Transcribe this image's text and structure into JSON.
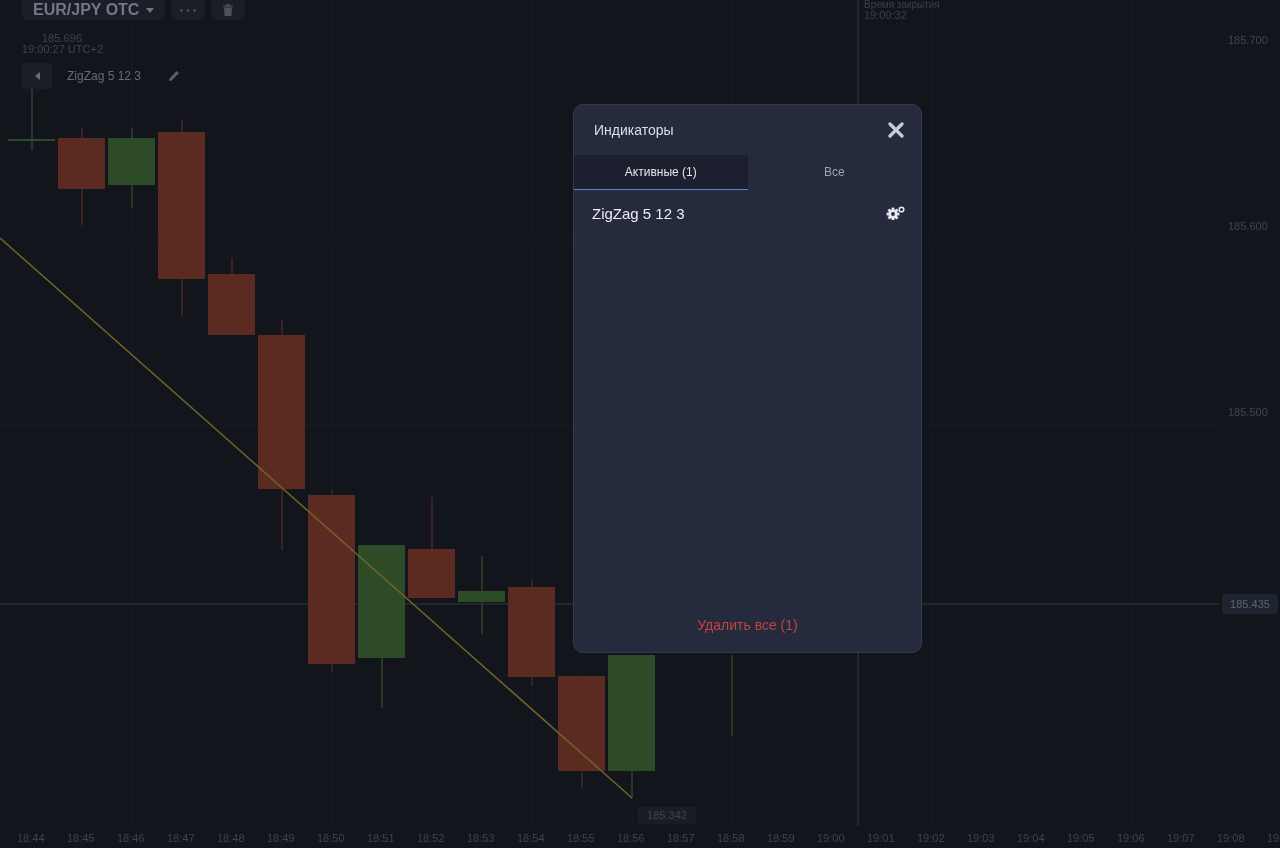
{
  "toolbar": {
    "symbol": "EUR/JPY OTC"
  },
  "crosshair": {
    "price": "185.696",
    "time": "19:00:27 UTC+2"
  },
  "indicator_legend": {
    "name": "ZigZag 5 12 3"
  },
  "close_time": {
    "label": "Время закрытия",
    "time": "19:00:32"
  },
  "chart": {
    "price_axis": [
      "185.700",
      "185.600",
      "185.500"
    ],
    "current_price": "185.435",
    "low_price": "185.342",
    "time_axis": [
      "18:44",
      "18:45",
      "18:46",
      "18:47",
      "18:48",
      "18:49",
      "18:50",
      "18:51",
      "18:52",
      "18:53",
      "18:54",
      "18:55",
      "18:56",
      "18:57",
      "18:58",
      "18:59",
      "19:00",
      "19:01",
      "19:02",
      "19:03",
      "19:04",
      "19:05",
      "19:06",
      "19:07",
      "19:08",
      "19"
    ]
  },
  "dialog": {
    "title": "Индикаторы",
    "tabs": [
      {
        "label": "Активные (1)",
        "selected": true
      },
      {
        "label": "Все",
        "selected": false
      }
    ],
    "indicators": [
      {
        "name": "ZigZag 5 12 3"
      }
    ],
    "delete_all": "Удалить все (1)"
  }
}
